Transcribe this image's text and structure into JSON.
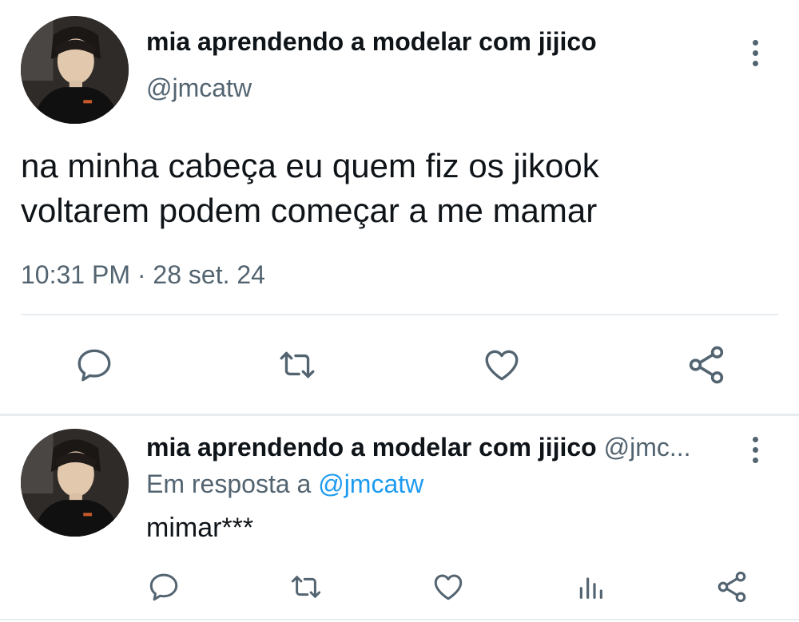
{
  "main_tweet": {
    "display_name": "mia aprendendo a modelar com jijico",
    "handle": "@jmcatw",
    "text": "na minha cabeça eu quem fiz os jikook voltarem podem começar a me mamar",
    "time": "10:31 PM",
    "separator": "·",
    "date": "28 set. 24"
  },
  "reply_tweet": {
    "display_name": "mia aprendendo a modelar com jijico",
    "handle_truncated": "@jmc...",
    "reply_prefix": "Em resposta a",
    "reply_to": "@jmcatw",
    "text": "mimar***"
  },
  "icons": {
    "reply": "reply-icon",
    "retweet": "retweet-icon",
    "like": "heart-icon",
    "views": "analytics-icon",
    "share": "share-icon",
    "more": "more-vertical-icon"
  },
  "colors": {
    "text": "#0f1419",
    "secondary": "#536471",
    "link": "#1d9bf0",
    "divider": "#e6ecf0"
  }
}
